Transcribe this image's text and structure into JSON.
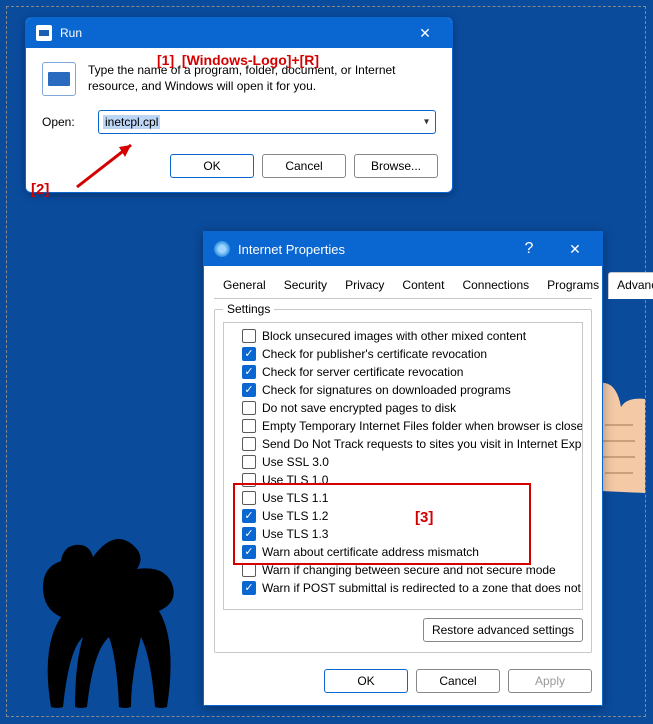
{
  "annotations": {
    "a1_num": "[1]",
    "a1_keys": "[Windows-Logo]+[R]",
    "a2": "[2]",
    "a3": "[3]"
  },
  "run": {
    "title": "Run",
    "description": "Type the name of a program, folder, document, or Internet resource, and Windows will open it for you.",
    "open_label": "Open:",
    "open_value": "inetcpl.cpl",
    "ok": "OK",
    "cancel": "Cancel",
    "browse": "Browse..."
  },
  "ip": {
    "title": "Internet Properties",
    "tabs": [
      "General",
      "Security",
      "Privacy",
      "Content",
      "Connections",
      "Programs",
      "Advanced"
    ],
    "active_tab": "Advanced",
    "settings_legend": "Settings",
    "settings": [
      {
        "checked": false,
        "label": "Block unsecured images with other mixed content"
      },
      {
        "checked": true,
        "label": "Check for publisher's certificate revocation"
      },
      {
        "checked": true,
        "label": "Check for server certificate revocation"
      },
      {
        "checked": true,
        "label": "Check for signatures on downloaded programs"
      },
      {
        "checked": false,
        "label": "Do not save encrypted pages to disk"
      },
      {
        "checked": false,
        "label": "Empty Temporary Internet Files folder when browser is closed"
      },
      {
        "checked": false,
        "label": "Send Do Not Track requests to sites you visit in Internet Explorer"
      },
      {
        "checked": false,
        "label": "Use SSL 3.0"
      },
      {
        "checked": false,
        "label": "Use TLS 1.0"
      },
      {
        "checked": false,
        "label": "Use TLS 1.1"
      },
      {
        "checked": true,
        "label": "Use TLS 1.2"
      },
      {
        "checked": true,
        "label": "Use TLS 1.3"
      },
      {
        "checked": true,
        "label": "Warn about certificate address mismatch"
      },
      {
        "checked": false,
        "label": "Warn if changing between secure and not secure mode"
      },
      {
        "checked": true,
        "label": "Warn if POST submittal is redirected to a zone that does not permit posts"
      }
    ],
    "restore": "Restore advanced settings",
    "ok": "OK",
    "cancel": "Cancel",
    "apply": "Apply"
  }
}
